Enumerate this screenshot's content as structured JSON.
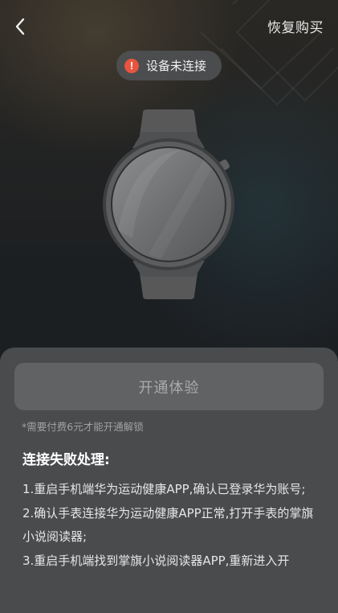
{
  "header": {
    "back_icon": "chevron-left-icon",
    "restore_label": "恢复购买"
  },
  "status": {
    "icon": "alert-icon",
    "icon_glyph": "!",
    "text": "设备未连接",
    "icon_color": "#e8543f"
  },
  "device": {
    "image": "smartwatch-icon"
  },
  "action": {
    "button_label": "开通体验",
    "fee_note": "*需要付费6元才能开通解锁"
  },
  "troubleshoot": {
    "title": "连接失败处理:",
    "steps": [
      "1.重启手机端华为运动健康APP,确认已登录华为账号;",
      "2.确认手表连接华为运动健康APP正常,打开手表的掌旗小说阅读器;",
      "3.重启手机端找到掌旗小说阅读器APP,重新进入开"
    ]
  },
  "colors": {
    "sheet_bg": "#4a4b4d",
    "button_bg": "#616264",
    "alert": "#e8543f"
  }
}
